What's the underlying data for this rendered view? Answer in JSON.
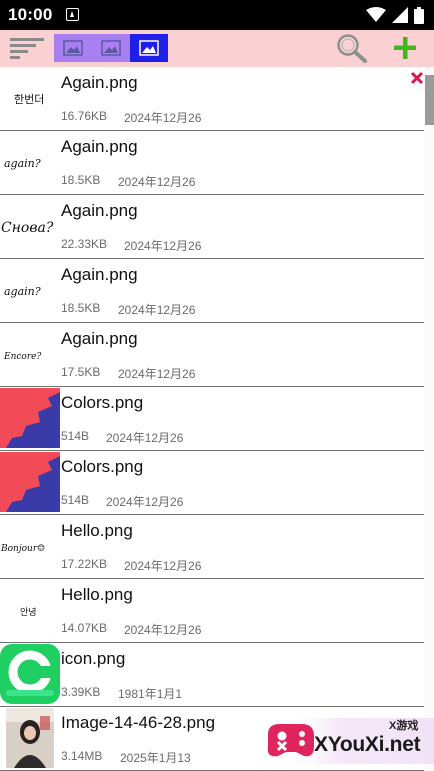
{
  "status_bar": {
    "time": "10:00"
  },
  "toolbar": {
    "icons": [
      "sort-lines-icon",
      "image-icon",
      "image-icon",
      "image-icon",
      "search-icon",
      "add-icon"
    ]
  },
  "files": [
    {
      "name": "Again.png",
      "size": "16.76KB",
      "date": "2024年12月26",
      "thumb": "handwriting-hangul"
    },
    {
      "name": "Again.png",
      "size": "18.5KB",
      "date": "2024年12月26",
      "thumb": "handwriting-again"
    },
    {
      "name": "Again.png",
      "size": "22.33KB",
      "date": "2024年12月26",
      "thumb": "handwriting-snova"
    },
    {
      "name": "Again.png",
      "size": "18.5KB",
      "date": "2024年12月26",
      "thumb": "handwriting-again"
    },
    {
      "name": "Again.png",
      "size": "17.5KB",
      "date": "2024年12月26",
      "thumb": "handwriting-encore"
    },
    {
      "name": "Colors.png",
      "size": "514B",
      "date": "2024年12月26",
      "thumb": "colors"
    },
    {
      "name": "Colors.png",
      "size": "514B",
      "date": "2024年12月26",
      "thumb": "colors"
    },
    {
      "name": "Hello.png",
      "size": "17.22KB",
      "date": "2024年12月26",
      "thumb": "handwriting-bonjour"
    },
    {
      "name": "Hello.png",
      "size": "14.07KB",
      "date": "2024年12月26",
      "thumb": "handwriting-annyeong"
    },
    {
      "name": "icon.png",
      "size": "3.39KB",
      "date": "1981年1月1",
      "thumb": "app-icon"
    },
    {
      "name": "Image-14-46-28.png",
      "size": "3.14MB",
      "date": "2025年1月13",
      "thumb": "photo"
    }
  ],
  "thumb_text": {
    "hangul": "한번더",
    "again": "again?",
    "snova": "Снова?",
    "encore": "Encore?",
    "bonjour": "Bonjour☺",
    "annyeong": "안녕"
  },
  "watermark": {
    "brand": "XYouXi.net",
    "tag": "X游戏"
  },
  "colors": {
    "toolbar_bg": "#fbd0d2",
    "view_button": "#a87ff0",
    "view_button_active": "#1f1fe8",
    "add": "#3fb81a",
    "delete": "#e0144c",
    "colors_red": "#f24a57",
    "colors_blue": "#3a3aa8",
    "app_icon_green": "#1fcf62"
  }
}
